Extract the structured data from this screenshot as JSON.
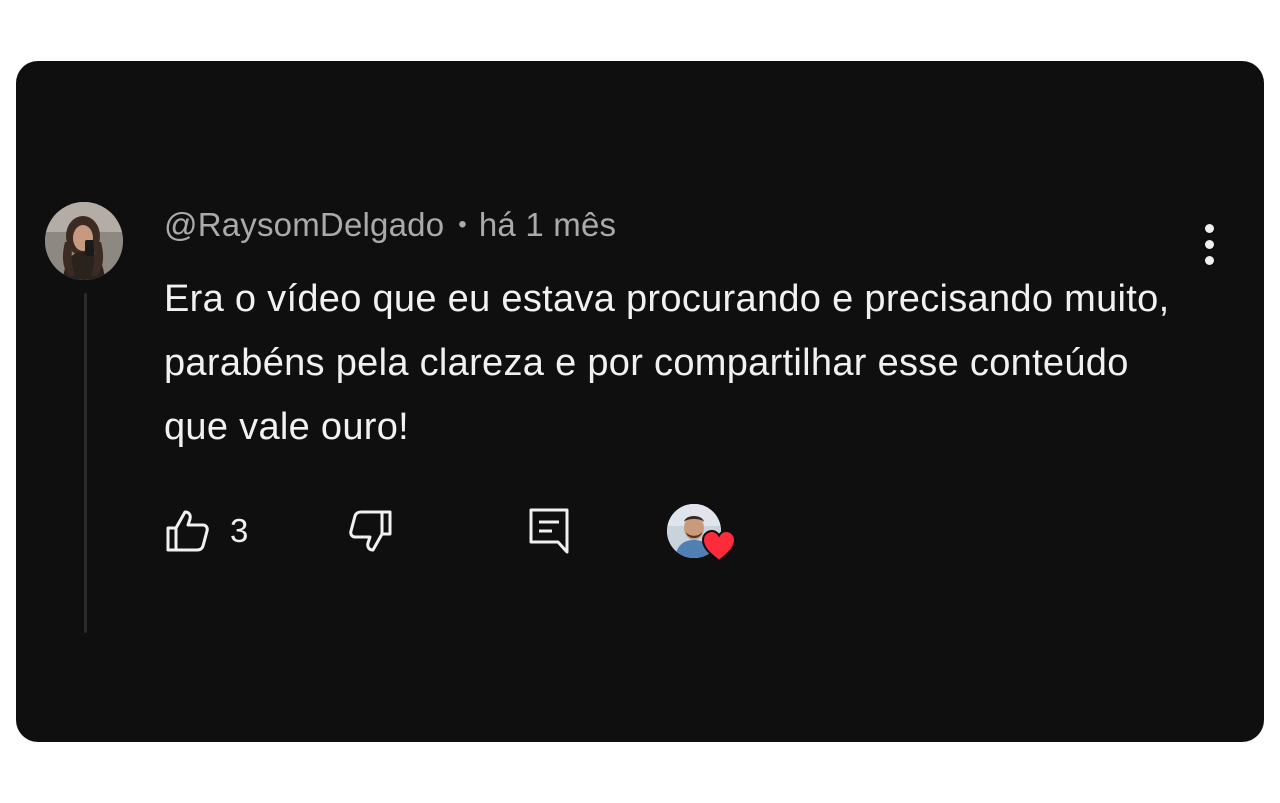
{
  "comment": {
    "author": "@RaysomDelgado",
    "separator": "•",
    "timestamp": "há 1 mês",
    "text": "Era o vídeo que eu estava procurando e precisando muito, parabéns pela clareza e por compartilhar esse conteúdo que vale ouro!",
    "like_count": "3"
  },
  "icons": {
    "like": "thumbs-up-icon",
    "dislike": "thumbs-down-icon",
    "reply": "reply-comment-icon",
    "menu": "more-vertical-icon",
    "creator_heart": "heart-icon"
  },
  "colors": {
    "background": "#0f0f10",
    "text_primary": "#f1f1f1",
    "text_secondary": "#aaaaaa",
    "heart": "#ff2b3a"
  }
}
